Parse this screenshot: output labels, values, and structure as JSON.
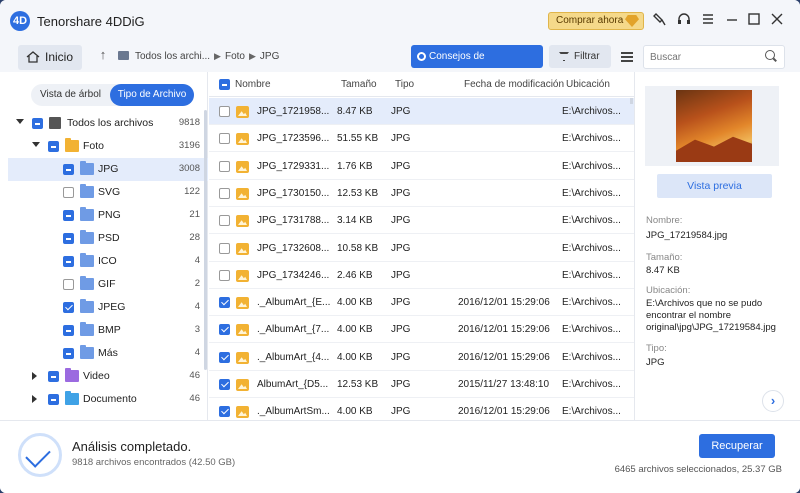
{
  "app": {
    "title": "Tenorshare 4DDiG",
    "logo": "4D",
    "buy_label": "Comprar ahora"
  },
  "window_icons": [
    "brush-icon",
    "headset-icon",
    "menu-icon",
    "minimize-icon",
    "maximize-icon",
    "close-icon"
  ],
  "toolbar": {
    "home_label": "Inicio",
    "breadcrumb": [
      "Todos los archi...",
      "Foto",
      "JPG"
    ],
    "tips_label": "Consejos de Recuperación",
    "filter_label": "Filtrar",
    "search_placeholder": "Buscar"
  },
  "left_panel": {
    "tabs": [
      {
        "label": "Vista de árbol"
      },
      {
        "label": "Tipo de Archivo"
      }
    ],
    "tree": [
      {
        "label": "Todos los archivos",
        "count": "9818",
        "checkbox": "partial",
        "expander": "down",
        "icon": "all"
      },
      {
        "label": "Foto",
        "count": "3196",
        "checkbox": "partial",
        "expander": "down",
        "icon": "foto"
      },
      {
        "label": "JPG",
        "count": "3008",
        "checkbox": "partial",
        "icon": "folder",
        "selected": true
      },
      {
        "label": "SVG",
        "count": "122",
        "checkbox": "off",
        "icon": "folder"
      },
      {
        "label": "PNG",
        "count": "21",
        "checkbox": "partial",
        "icon": "folder"
      },
      {
        "label": "PSD",
        "count": "28",
        "checkbox": "partial",
        "icon": "folder"
      },
      {
        "label": "ICO",
        "count": "4",
        "checkbox": "partial",
        "icon": "folder"
      },
      {
        "label": "GIF",
        "count": "2",
        "checkbox": "off",
        "icon": "folder"
      },
      {
        "label": "JPEG",
        "count": "4",
        "checkbox": "on",
        "icon": "folder"
      },
      {
        "label": "BMP",
        "count": "3",
        "checkbox": "partial",
        "icon": "folder"
      },
      {
        "label": "Más",
        "count": "4",
        "checkbox": "partial",
        "icon": "folder"
      },
      {
        "label": "Video",
        "count": "46",
        "checkbox": "partial",
        "expander": "right",
        "icon": "video"
      },
      {
        "label": "Documento",
        "count": "46",
        "checkbox": "partial",
        "expander": "right",
        "icon": "doc"
      }
    ]
  },
  "file_list": {
    "columns": [
      "Nombre",
      "Tamaño",
      "Tipo",
      "Fecha de modificación",
      "Ubicación"
    ],
    "rows": [
      {
        "name": "JPG_1721958...",
        "size": "8.47 KB",
        "type": "JPG",
        "date": "",
        "location": "E:\\Archivos...",
        "checked": false,
        "selected": true
      },
      {
        "name": "JPG_1723596...",
        "size": "51.55 KB",
        "type": "JPG",
        "date": "",
        "location": "E:\\Archivos...",
        "checked": false
      },
      {
        "name": "JPG_1729331...",
        "size": "1.76 KB",
        "type": "JPG",
        "date": "",
        "location": "E:\\Archivos...",
        "checked": false
      },
      {
        "name": "JPG_1730150...",
        "size": "12.53 KB",
        "type": "JPG",
        "date": "",
        "location": "E:\\Archivos...",
        "checked": false
      },
      {
        "name": "JPG_1731788...",
        "size": "3.14 KB",
        "type": "JPG",
        "date": "",
        "location": "E:\\Archivos...",
        "checked": false
      },
      {
        "name": "JPG_1732608...",
        "size": "10.58 KB",
        "type": "JPG",
        "date": "",
        "location": "E:\\Archivos...",
        "checked": false
      },
      {
        "name": "JPG_1734246...",
        "size": "2.46 KB",
        "type": "JPG",
        "date": "",
        "location": "E:\\Archivos...",
        "checked": false
      },
      {
        "name": "._AlbumArt_{E...",
        "size": "4.00 KB",
        "type": "JPG",
        "date": "2016/12/01 15:29:06",
        "location": "E:\\Archivos...",
        "checked": true
      },
      {
        "name": "._AlbumArt_{7...",
        "size": "4.00 KB",
        "type": "JPG",
        "date": "2016/12/01 15:29:06",
        "location": "E:\\Archivos...",
        "checked": true
      },
      {
        "name": "._AlbumArt_{4...",
        "size": "4.00 KB",
        "type": "JPG",
        "date": "2016/12/01 15:29:06",
        "location": "E:\\Archivos...",
        "checked": true
      },
      {
        "name": "AlbumArt_{D5...",
        "size": "12.53 KB",
        "type": "JPG",
        "date": "2015/11/27 13:48:10",
        "location": "E:\\Archivos...",
        "checked": true
      },
      {
        "name": "._AlbumArtSm...",
        "size": "4.00 KB",
        "type": "JPG",
        "date": "2016/12/01 15:29:06",
        "location": "E:\\Archivos...",
        "checked": true
      }
    ]
  },
  "preview": {
    "button_label": "Vista previa",
    "name_label": "Nombre:",
    "name_value": "JPG_17219584.jpg",
    "size_label": "Tamaño:",
    "size_value": "8.47 KB",
    "location_label": "Ubicación:",
    "location_value": "E:\\Archivos que no se pudo encontrar el nombre original\\jpg\\JPG_17219584.jpg",
    "type_label": "Tipo:",
    "type_value": "JPG",
    "next_label": "›"
  },
  "footer": {
    "status_title": "Análisis completado.",
    "status_sub": "9818 archivos encontrados (42.50 GB)",
    "recover_label": "Recuperar",
    "selected_info": "6465 archivos seleccionados, 25.37 GB"
  },
  "colors": {
    "accent": "#2d6ee0",
    "selected_row": "#e4ecfb",
    "buy_bg": "#f5d98a"
  }
}
